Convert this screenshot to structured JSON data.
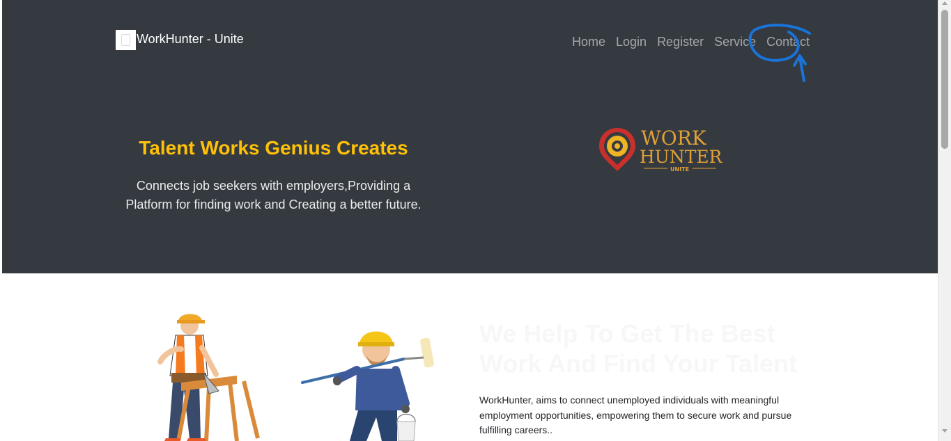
{
  "brand": {
    "name": "WorkHunter - Unite",
    "logo_icon": "broken-image-icon"
  },
  "nav": {
    "items": [
      {
        "label": "Home"
      },
      {
        "label": "Login"
      },
      {
        "label": "Register"
      },
      {
        "label": "Service"
      },
      {
        "label": "Contact"
      }
    ]
  },
  "hero": {
    "title": "Talent Works Genius Creates",
    "subtitle": "Connects job seekers with employers,Providing a Platform for finding work and Creating a better future."
  },
  "logo": {
    "line1": "WORK",
    "line2": "HUNTER",
    "line3": "UNITE"
  },
  "about": {
    "title": "We Help To Get The Best Work And Find Your Talent",
    "text": "WorkHunter, aims to connect unemployed individuals with meaningful employment opportunities, empowering them to secure work and pursue fulfilling careers.."
  },
  "colors": {
    "hero_bg": "#343a40",
    "accent": "#ffc107",
    "annotation": "#1a73d9"
  }
}
